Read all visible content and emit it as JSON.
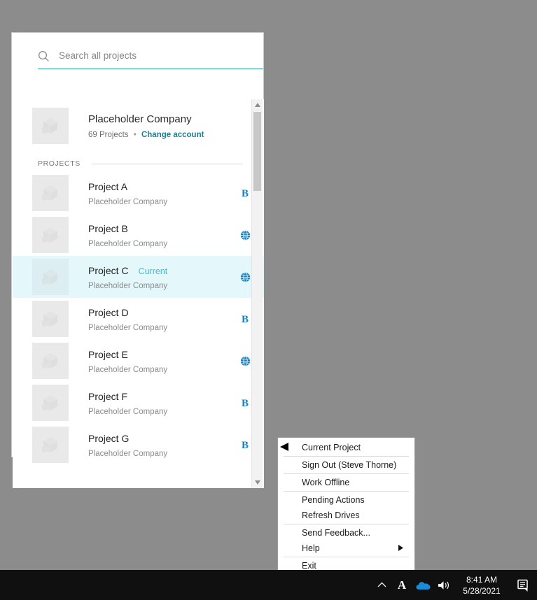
{
  "search": {
    "placeholder": "Search all projects",
    "value": "",
    "icon": "search-icon"
  },
  "account": {
    "name": "Placeholder Company",
    "projects_count": "69 Projects",
    "separator": "•",
    "change_account_label": "Change account",
    "thumbnail_icon": "image-placeholder-icon"
  },
  "section": {
    "label": "PROJECTS"
  },
  "projects": [
    {
      "name": "Project A",
      "company": "Placeholder Company",
      "badge": "bim360-b-icon",
      "current": false,
      "current_label": ""
    },
    {
      "name": "Project B",
      "company": "Placeholder Company",
      "badge": "globe-icon",
      "current": false,
      "current_label": ""
    },
    {
      "name": "Project C",
      "company": "Placeholder Company",
      "badge": "globe-icon",
      "current": true,
      "current_label": "Current"
    },
    {
      "name": "Project D",
      "company": "Placeholder Company",
      "badge": "bim360-b-icon",
      "current": false,
      "current_label": ""
    },
    {
      "name": "Project E",
      "company": "Placeholder Company",
      "badge": "globe-icon",
      "current": false,
      "current_label": ""
    },
    {
      "name": "Project F",
      "company": "Placeholder Company",
      "badge": "bim360-b-icon",
      "current": false,
      "current_label": ""
    },
    {
      "name": "Project G",
      "company": "Placeholder Company",
      "badge": "bim360-b-icon",
      "current": false,
      "current_label": ""
    }
  ],
  "scrollbar": {
    "up_arrow": "▲",
    "down_arrow": "▼"
  },
  "context_menu": {
    "groups": [
      {
        "items": [
          {
            "label": "Current Project",
            "submenu": false
          }
        ]
      },
      {
        "items": [
          {
            "label": "Sign Out (Steve Thorne)",
            "submenu": false
          }
        ]
      },
      {
        "items": [
          {
            "label": "Work Offline",
            "submenu": false
          }
        ]
      },
      {
        "items": [
          {
            "label": "Pending Actions",
            "submenu": false
          },
          {
            "label": "Refresh Drives",
            "submenu": false
          }
        ]
      },
      {
        "items": [
          {
            "label": "Send Feedback...",
            "submenu": false
          },
          {
            "label": "Help",
            "submenu": true,
            "submenu_arrow": "▶"
          }
        ]
      },
      {
        "items": [
          {
            "label": "Exit",
            "submenu": false
          }
        ]
      }
    ]
  },
  "taskbar": {
    "tray_chevron": "⌃",
    "autodesk_icon": "A",
    "cloud_icon": "onedrive-cloud-icon",
    "speaker_icon": "volume-icon",
    "time": "8:41 AM",
    "date": "5/28/2021",
    "notification_icon": "action-center-icon"
  },
  "colors": {
    "accent": "#2b9aab",
    "link": "#1d7f93",
    "current_tag": "#39c2d8",
    "current_row_bg": "#e4f7fa",
    "badge_blue": "#1a7fc1",
    "desktop": "#8c8c8c",
    "taskbar": "#101010"
  }
}
